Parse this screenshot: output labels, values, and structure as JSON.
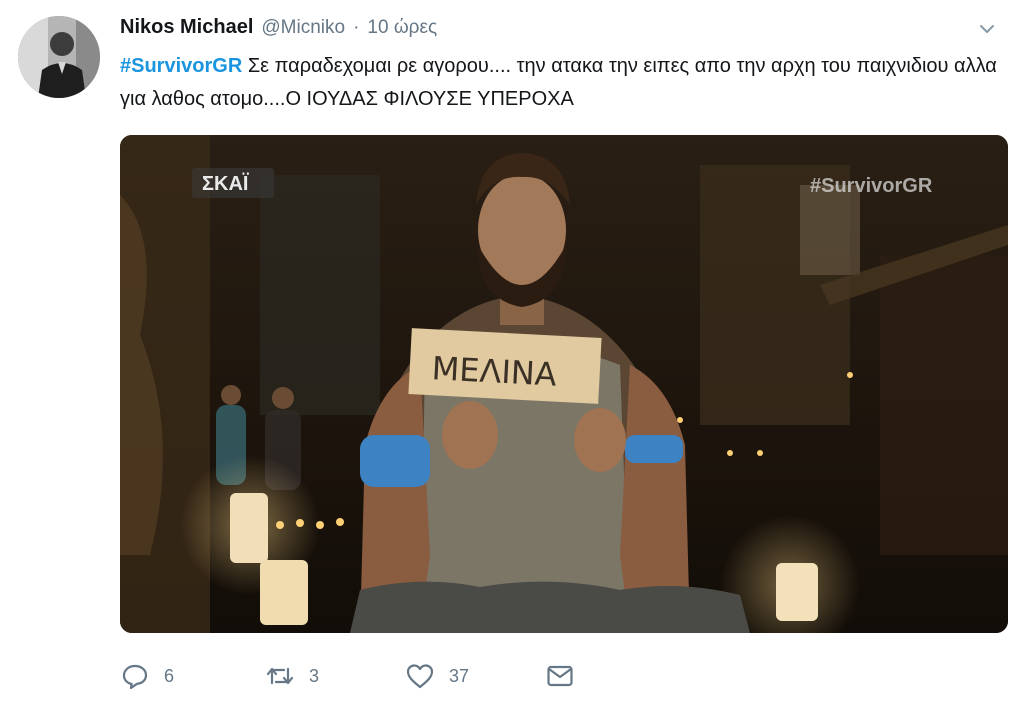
{
  "author": {
    "name": "Nikos Michael",
    "handle": "@Micniko",
    "separator": "·",
    "time": "10 ώρες"
  },
  "tweet": {
    "hashtag": "#SurvivorGR",
    "text": " Σε παραδεχομαι ρε αγορου.... την ατακα την ειπες απο την αρχη του παιχνιδιου αλλα για λαθος ατομο....Ο ΙΟΥΔΑΣ ΦΙΛΟΥΣΕ ΥΠΕΡΟΧΑ"
  },
  "media": {
    "channel_logo": "ΣΚΑΪ",
    "watermark": "#SurvivorGR",
    "sign_text": "ΜΕΛΙΝΑ"
  },
  "actions": {
    "reply": {
      "icon": "reply-icon",
      "count": "6"
    },
    "retweet": {
      "icon": "retweet-icon",
      "count": "3"
    },
    "like": {
      "icon": "heart-icon",
      "count": "37"
    },
    "dm": {
      "icon": "envelope-icon"
    }
  },
  "colors": {
    "hashtag": "#1b95e0",
    "secondary_text": "#657786",
    "icon": "#657786"
  }
}
